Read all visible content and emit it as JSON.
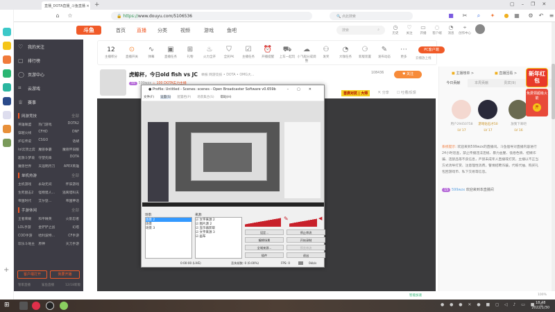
{
  "browser": {
    "tab_title": "直播_DOTA直播_斗鱼直播",
    "url_scheme": "https://",
    "url_rest": "www.douyu.com/5106536",
    "search_placeholder": "点此搜索"
  },
  "watermark": {
    "text": "DOUYU.COM"
  },
  "header": {
    "logo": "斗鱼",
    "nav": [
      "首页",
      "直播",
      "分类",
      "视频",
      "游戏",
      "鱼吧"
    ],
    "active_nav": "直播",
    "search_placeholder": "搜索",
    "icons": [
      {
        "label": "历史",
        "icon": "clock-icon"
      },
      {
        "label": "关注",
        "icon": "heart-icon"
      },
      {
        "label": "开播",
        "icon": "camera-icon"
      },
      {
        "label": "客户端",
        "icon": "client-icon",
        "badge": "1"
      },
      {
        "label": "消息",
        "icon": "bell-icon",
        "badge": "9"
      },
      {
        "label": "创作中心",
        "icon": "pin-icon"
      }
    ],
    "avatar_badge": "20"
  },
  "left_sidebar": {
    "top_items": [
      "我的关注",
      "排行榜",
      "页游中心",
      "云游戏",
      "赛事"
    ],
    "sections": [
      {
        "title": "网游竞技",
        "more": "全部",
        "items": [
          "英雄联盟",
          "热门游戏",
          "DOTA2",
          "穿越火线",
          "CFHD",
          "DNF",
          "炉石传说",
          "CSGO",
          "话胡",
          "lol云顶之弈",
          "魔兽争霸",
          "魔兽怀旧服",
          "超激斗梦境",
          "守望先锋",
          "DOTA",
          "魔兽世界",
          "天涯明月刀",
          "APEX英雄"
        ]
      },
      {
        "title": "单机热游",
        "more": "全部",
        "items": [
          "主机游戏",
          "永劫无间",
          "怀旧游戏",
          "生死狙击2",
          "怪物猎人...",
          "逃离塔科夫",
          "帝国时代",
          "艾尔登...",
          "帝国神话"
        ]
      },
      {
        "title": "手游休闲",
        "more": "全部",
        "items": [
          "王者荣耀",
          "和平精英",
          "火影忍者",
          "LOL手游",
          "金铲铲之战",
          "幻塔",
          "COD手游",
          "哈利波特...",
          "CF手游",
          "欢乐斗地主",
          "原神",
          "天刀手游"
        ]
      }
    ],
    "buttons": [
      "客户端打开",
      "我要开播"
    ],
    "footer": [
      "管家直播",
      "鲨鱼直播",
      "12/18新版"
    ]
  },
  "toolbar": {
    "count": "12",
    "count_label": "主播积分",
    "items": [
      "直播开关",
      "弹幕",
      "直播任务",
      "礼物",
      "火力全开",
      "全民PK",
      "主播任务",
      "开播提醒",
      "上车一起玩",
      "小飞船分成调整",
      "发奖",
      "大咖任务",
      "新版装置",
      "发布动态",
      "更多"
    ],
    "pc_button": "PC客户端",
    "pc_sub": "云播放上线"
  },
  "room": {
    "title": "虎鲸杯，今日old fish vs JC",
    "tag": "举报",
    "category": "网游竞技 • DOTA • OMG大...",
    "level": "55",
    "host": "599wzx",
    "hot": "100",
    "tag2": "DOTA实力主播",
    "followers": "108436",
    "follow": "关注",
    "share": "分享",
    "report": "吐槽/反馈",
    "banner": "首席对抗 | 大师"
  },
  "obs": {
    "title": "Profile: Untitled - Scenes: scenes - Open Broadcaster Software v0.659b",
    "menu": [
      "文件(F)",
      "设置(S)",
      "配置档(P)",
      "场景集合(S)",
      "帮助(H)"
    ],
    "scenes_label": "场景:",
    "scenes": [
      "场景 2",
      "场景",
      "场景 3"
    ],
    "sources_label": "来源:",
    "sources": [
      "文字来源 2",
      "图片源 2",
      "显示器获取",
      "文字来源 3",
      "画布"
    ],
    "buttons": [
      "设定...",
      "停止串流",
      "编辑场景",
      "开始录制",
      "全域来源...",
      "预览串流",
      "插件",
      "退出"
    ],
    "status": {
      "time": "0:00:00 (LIVE)",
      "dropped": "丢失帧数: 0 (0.00%)",
      "fps": "FPS: 0",
      "rate": "0kb/s"
    }
  },
  "right_panel": {
    "links": [
      "主播榜单 >",
      "直播回看 >"
    ],
    "tabs": [
      "今日贡献",
      "本周贡献",
      "贵宾(9)",
      "粉丝"
    ],
    "fans": [
      {
        "name": "用户29450758",
        "level": "LV 17"
      },
      {
        "name": "游戏钻石才50",
        "level": "LV 17"
      },
      {
        "name": "放我下来吧",
        "level": "LV 16"
      }
    ],
    "system_label": "系统提示:",
    "system_msg": "欢迎来到599wzx的直播间。斗鱼倡导对直播内容进行24小时巡查，禁止传播违法违规、暴力血腥、低俗色情、招嫖诈骗、违禁品等不良信息，严禁未成年人直播或打赏，主播以不正当方式诱导打赏、注意理性消费，警惕招聘诈骗，代练代抽、购买礼包回游戏币、私下交易等信息。",
    "welcome_user": "599wzx",
    "welcome_msg": "欢迎来到本直播间",
    "redpack_title": "新年红包",
    "redpack_sub": "免费领超级火箭",
    "redpack_btn": "开"
  },
  "statusbar": {
    "items": [
      "智能加速",
      "100%"
    ]
  },
  "taskbar": {
    "time": "18:48",
    "date": "2022/1/30"
  }
}
